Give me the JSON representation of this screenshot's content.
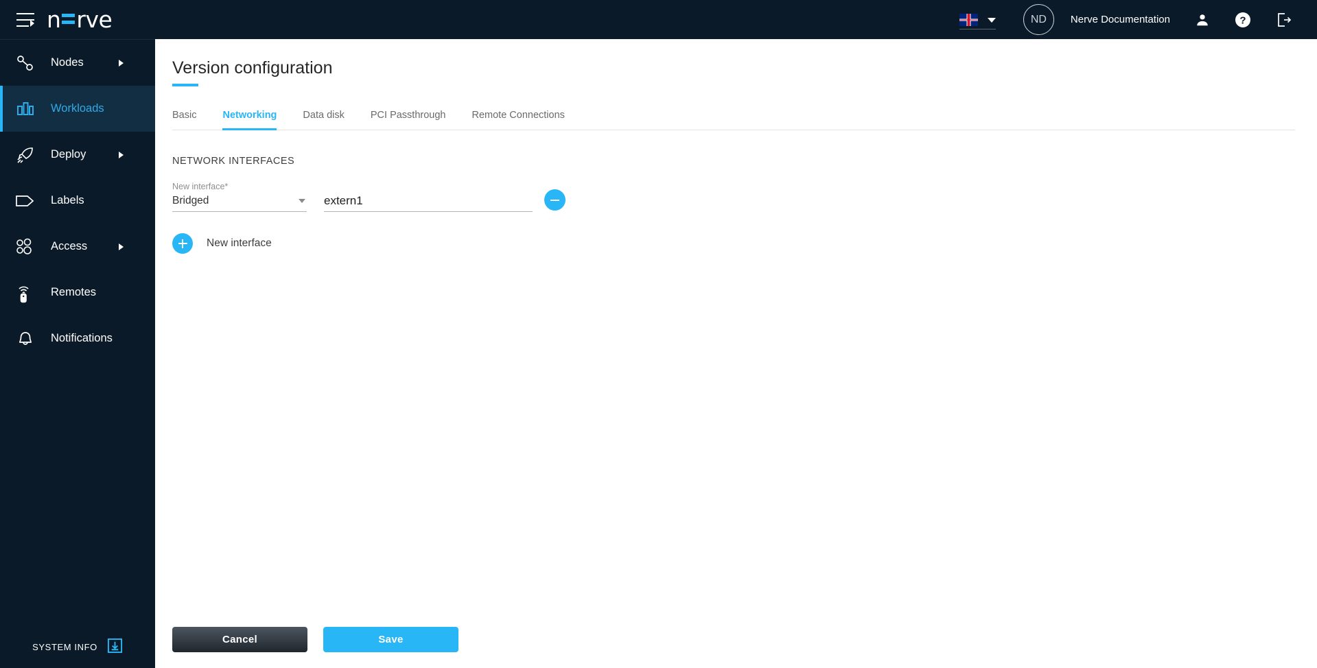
{
  "colors": {
    "accent": "#29b6f6",
    "sidebar_bg": "#0b1a28",
    "sidebar_active_bg": "#112e42",
    "topbar_bg": "#0b1a28"
  },
  "topbar": {
    "menu_icon": "hamburger-icon",
    "logo_text_1": "n",
    "logo_text_2": "rve",
    "language_flag": "uk-flag-icon",
    "avatar_initials": "ND",
    "documentation_label": "Nerve Documentation",
    "user_icon": "user-icon",
    "help_icon": "help-icon",
    "logout_icon": "logout-icon"
  },
  "sidebar": {
    "items": [
      {
        "label": "Nodes",
        "icon": "nodes-icon",
        "active": false,
        "has_arrow": true
      },
      {
        "label": "Workloads",
        "icon": "workloads-icon",
        "active": true,
        "has_arrow": false
      },
      {
        "label": "Deploy",
        "icon": "deploy-icon",
        "active": false,
        "has_arrow": true
      },
      {
        "label": "Labels",
        "icon": "labels-icon",
        "active": false,
        "has_arrow": false
      },
      {
        "label": "Access",
        "icon": "access-icon",
        "active": false,
        "has_arrow": true
      },
      {
        "label": "Remotes",
        "icon": "remotes-icon",
        "active": false,
        "has_arrow": false
      },
      {
        "label": "Notifications",
        "icon": "notifications-icon",
        "active": false,
        "has_arrow": false
      }
    ],
    "system_info_label": "SYSTEM INFO",
    "system_info_icon": "download-icon"
  },
  "main": {
    "page_title": "Version configuration",
    "tabs": [
      {
        "label": "Basic",
        "active": false
      },
      {
        "label": "Networking",
        "active": true
      },
      {
        "label": "Data disk",
        "active": false
      },
      {
        "label": "PCI Passthrough",
        "active": false
      },
      {
        "label": "Remote Connections",
        "active": false
      }
    ],
    "section_title": "NETWORK INTERFACES",
    "interface": {
      "type_label": "New interface*",
      "type_value": "Bridged",
      "name_value": "extern1",
      "name_placeholder": "",
      "remove_icon": "minus-icon"
    },
    "add_interface": {
      "label": "New interface",
      "icon": "plus-icon"
    },
    "footer": {
      "cancel_label": "Cancel",
      "save_label": "Save"
    }
  }
}
